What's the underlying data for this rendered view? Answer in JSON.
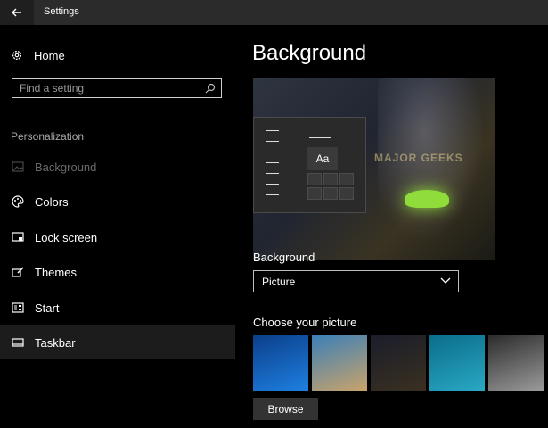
{
  "window": {
    "title": "Settings"
  },
  "sidebar": {
    "home_label": "Home",
    "search_placeholder": "Find a setting",
    "section_label": "Personalization",
    "items": [
      {
        "label": "Background",
        "icon": "picture-icon",
        "state": "disabled"
      },
      {
        "label": "Colors",
        "icon": "palette-icon",
        "state": "normal"
      },
      {
        "label": "Lock screen",
        "icon": "lock-screen-icon",
        "state": "normal"
      },
      {
        "label": "Themes",
        "icon": "themes-brush-icon",
        "state": "normal"
      },
      {
        "label": "Start",
        "icon": "start-menu-icon",
        "state": "normal"
      },
      {
        "label": "Taskbar",
        "icon": "taskbar-icon",
        "state": "selected"
      }
    ]
  },
  "main": {
    "title": "Background",
    "preview": {
      "tile_text": "Aa",
      "watermark": "MAJOR GEEKS"
    },
    "background_label": "Background",
    "background_value": "Picture",
    "choose_label": "Choose your picture",
    "thumbnails": [
      {
        "name": "windows-hero",
        "colors": [
          "#0b3f8a",
          "#1e7fe0"
        ]
      },
      {
        "name": "beach-rocks",
        "colors": [
          "#3b7fb8",
          "#c9a36a"
        ]
      },
      {
        "name": "night-tent",
        "colors": [
          "#1a1d2a",
          "#3a3020"
        ]
      },
      {
        "name": "underwater-swimmer",
        "colors": [
          "#0a6d8a",
          "#29a8c4"
        ]
      },
      {
        "name": "rock-cliff",
        "colors": [
          "#2c2c2c",
          "#9a9a9a"
        ]
      }
    ],
    "browse_label": "Browse"
  }
}
